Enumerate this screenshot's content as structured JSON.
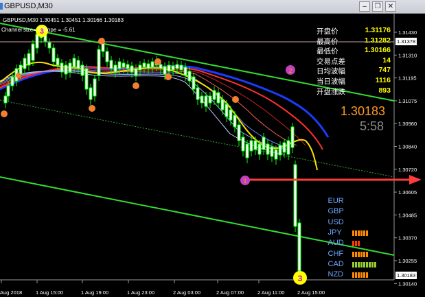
{
  "window": {
    "title": "GBPUSD,M30"
  },
  "chart_header": {
    "symbol_info": "GBPUSD,M30  1.30451 1.30451 1.30166 1.30183",
    "channel_info": "Channel size=   6 Slope = -5.61"
  },
  "info_panel": [
    {
      "label": "开盘价",
      "value": "1.31176"
    },
    {
      "label": "最高价",
      "value": "1.31282"
    },
    {
      "label": "最低价",
      "value": "1.30166"
    },
    {
      "label": "交易点差",
      "value": "14"
    },
    {
      "label": "日均波幅",
      "value": "747"
    },
    {
      "label": "当日波幅",
      "value": "1116"
    },
    {
      "label": "开盘涨跌",
      "value": "893"
    }
  ],
  "current_price": "1.30183",
  "candle_timer": "5:58",
  "price_axis": {
    "ticks": [
      "1.31430",
      "1.31310",
      "1.31195",
      "1.31075",
      "1.30960",
      "1.30840",
      "1.30720",
      "1.30605",
      "1.30485",
      "1.30370",
      "1.30255",
      "1.30140"
    ],
    "marker_high": "1.31378",
    "marker_current": "1.30183"
  },
  "time_axis": [
    "Aug 2018",
    "1 Aug 15:00",
    "1 Aug 19:00",
    "1 Aug 23:00",
    "2 Aug 03:00",
    "2 Aug 07:00",
    "2 Aug 11:00",
    "2 Aug 15:00"
  ],
  "currency_strength": [
    {
      "name": "EUR",
      "bars": 0,
      "color": "#ff8c00"
    },
    {
      "name": "GBP",
      "bars": 0,
      "color": "#ff8c00"
    },
    {
      "name": "USD",
      "bars": 0,
      "color": "#ff8c00"
    },
    {
      "name": "JPY",
      "bars": 6,
      "color": "#ff8c00"
    },
    {
      "name": "AUD",
      "bars": 3,
      "color": "#ff3b00"
    },
    {
      "name": "CHF",
      "bars": 6,
      "color": "#ff8c00"
    },
    {
      "name": "CAD",
      "bars": 9,
      "color": "#9acd32"
    },
    {
      "name": "NZD",
      "bars": 6,
      "color": "#ff8c00"
    }
  ],
  "markers": {
    "top_left": "3",
    "top_right": "2",
    "mid": "1",
    "bottom": "3"
  },
  "colors": {
    "background": "#000000",
    "bull_candle": "#ffffff",
    "bear_candle": "#00ff00",
    "channel": "#33dd33",
    "price_line": "#ff3b3b"
  }
}
